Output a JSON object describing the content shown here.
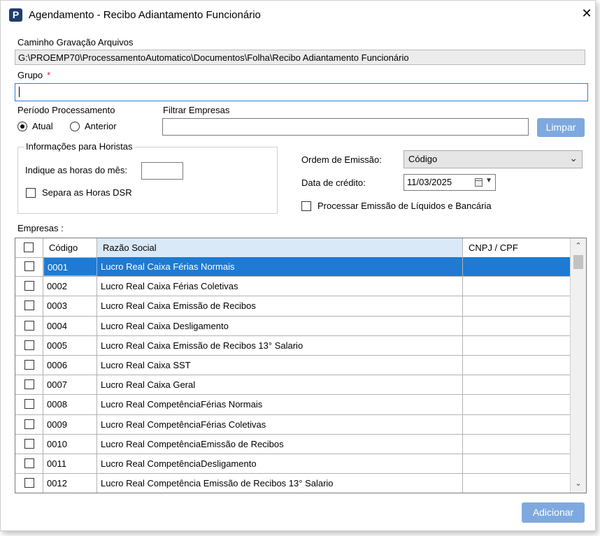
{
  "window": {
    "title": "Agendamento - Recibo Adiantamento Funcionário",
    "app_icon_letter": "P",
    "close_glyph": "✕"
  },
  "path": {
    "label": "Caminho Gravação Arquivos",
    "value": "G:\\PROEMP70\\ProcessamentoAutomatico\\Documentos\\Folha\\Recibo Adiantamento Funcionário"
  },
  "grupo": {
    "label": "Grupo",
    "required_mark": "*",
    "value": ""
  },
  "periodo": {
    "label": "Período Processamento",
    "options": [
      "Atual",
      "Anterior"
    ],
    "selected": "Atual"
  },
  "filtro": {
    "label": "Filtrar Empresas",
    "value": "",
    "clear_button": "Limpar"
  },
  "horistas": {
    "title": "Informações para Horistas",
    "horas_label": "Indique as horas do mês:",
    "horas_value": "",
    "dsr_label": "Separa as Horas DSR"
  },
  "ordem": {
    "label": "Ordem de Emissão:",
    "value": "Código"
  },
  "credito": {
    "label": "Data de crédito:",
    "value": "11/03/2025"
  },
  "liquidos": {
    "label": "Processar Emissão de Líquidos e Bancária"
  },
  "empresas": {
    "label": "Empresas :",
    "columns": [
      "Código",
      "Razão Social",
      "CNPJ / CPF"
    ],
    "rows": [
      {
        "codigo": "0001",
        "razao": "Lucro Real Caixa Férias Normais",
        "cnpj": ""
      },
      {
        "codigo": "0002",
        "razao": "Lucro Real Caixa Férias Coletivas",
        "cnpj": ""
      },
      {
        "codigo": "0003",
        "razao": "Lucro Real Caixa Emissão de Recibos",
        "cnpj": ""
      },
      {
        "codigo": "0004",
        "razao": "Lucro Real Caixa Desligamento",
        "cnpj": ""
      },
      {
        "codigo": "0005",
        "razao": "Lucro Real Caixa Emissão de Recibos 13° Salario",
        "cnpj": ""
      },
      {
        "codigo": "0006",
        "razao": "Lucro Real Caixa SST",
        "cnpj": ""
      },
      {
        "codigo": "0007",
        "razao": "Lucro Real Caixa Geral",
        "cnpj": ""
      },
      {
        "codigo": "0008",
        "razao": "Lucro Real CompetênciaFérias Normais",
        "cnpj": ""
      },
      {
        "codigo": "0009",
        "razao": "Lucro Real CompetênciaFérias Coletivas",
        "cnpj": ""
      },
      {
        "codigo": "0010",
        "razao": "Lucro Real CompetênciaEmissão de Recibos",
        "cnpj": ""
      },
      {
        "codigo": "0011",
        "razao": "Lucro Real CompetênciaDesligamento",
        "cnpj": ""
      },
      {
        "codigo": "0012",
        "razao": "Lucro Real Competência Emissão de Recibos 13° Salario",
        "cnpj": ""
      }
    ]
  },
  "actions": {
    "add_button": "Adicionar"
  },
  "colors": {
    "accent": "#7fa9de",
    "selection": "#1e7ad3",
    "header_bg": "#d9e9f7"
  }
}
